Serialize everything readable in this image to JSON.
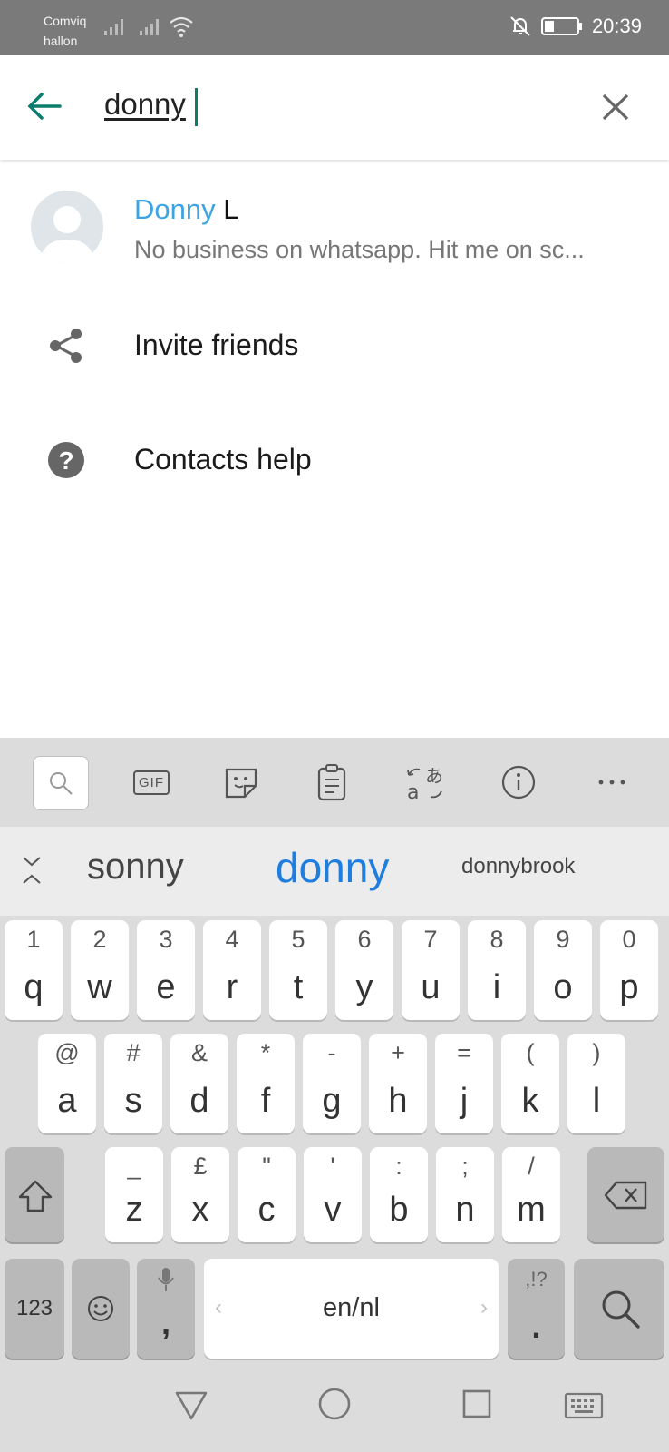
{
  "status_bar": {
    "carrier_1": "Comviq",
    "carrier_2": "hallon",
    "time": "20:39",
    "icons": [
      "signal-icon",
      "signal-icon",
      "wifi-icon",
      "mute-bell-icon",
      "battery-icon"
    ]
  },
  "search": {
    "query": "donny",
    "back_icon": "arrow-left-icon",
    "clear_icon": "close-icon"
  },
  "results": [
    {
      "name_highlight": "Donny",
      "name_rest": " L",
      "status": "No business on whatsapp. Hit me on sc..."
    }
  ],
  "menu": {
    "invite": "Invite friends",
    "help": "Contacts help"
  },
  "keyboard": {
    "toolbar": [
      "search-icon",
      "GIF",
      "sticker-icon",
      "clipboard-icon",
      "translate-icon",
      "info-icon",
      "more-icon"
    ],
    "gif_label": "GIF",
    "suggestions": [
      "sonny",
      "donny",
      "donnybrook"
    ],
    "row1": [
      {
        "hint": "1",
        "key": "q"
      },
      {
        "hint": "2",
        "key": "w"
      },
      {
        "hint": "3",
        "key": "e"
      },
      {
        "hint": "4",
        "key": "r"
      },
      {
        "hint": "5",
        "key": "t"
      },
      {
        "hint": "6",
        "key": "y"
      },
      {
        "hint": "7",
        "key": "u"
      },
      {
        "hint": "8",
        "key": "i"
      },
      {
        "hint": "9",
        "key": "o"
      },
      {
        "hint": "0",
        "key": "p"
      }
    ],
    "row2": [
      {
        "hint": "@",
        "key": "a"
      },
      {
        "hint": "#",
        "key": "s"
      },
      {
        "hint": "&",
        "key": "d"
      },
      {
        "hint": "*",
        "key": "f"
      },
      {
        "hint": "-",
        "key": "g"
      },
      {
        "hint": "+",
        "key": "h"
      },
      {
        "hint": "=",
        "key": "j"
      },
      {
        "hint": "(",
        "key": "k"
      },
      {
        "hint": ")",
        "key": "l"
      }
    ],
    "row3": [
      {
        "hint": "_",
        "key": "z"
      },
      {
        "hint": "£",
        "key": "x"
      },
      {
        "hint": "\"",
        "key": "c"
      },
      {
        "hint": "'",
        "key": "v"
      },
      {
        "hint": ":",
        "key": "b"
      },
      {
        "hint": ";",
        "key": "n"
      },
      {
        "hint": "/",
        "key": "m"
      }
    ],
    "num_label": "123",
    "comma_label": ",",
    "space_label": "en/nl",
    "punct_hint": ",!?",
    "period_label": "."
  },
  "colors": {
    "accent": "#0b7d6b",
    "highlight": "#3da4e3",
    "suggest_selected": "#1f7de0"
  }
}
